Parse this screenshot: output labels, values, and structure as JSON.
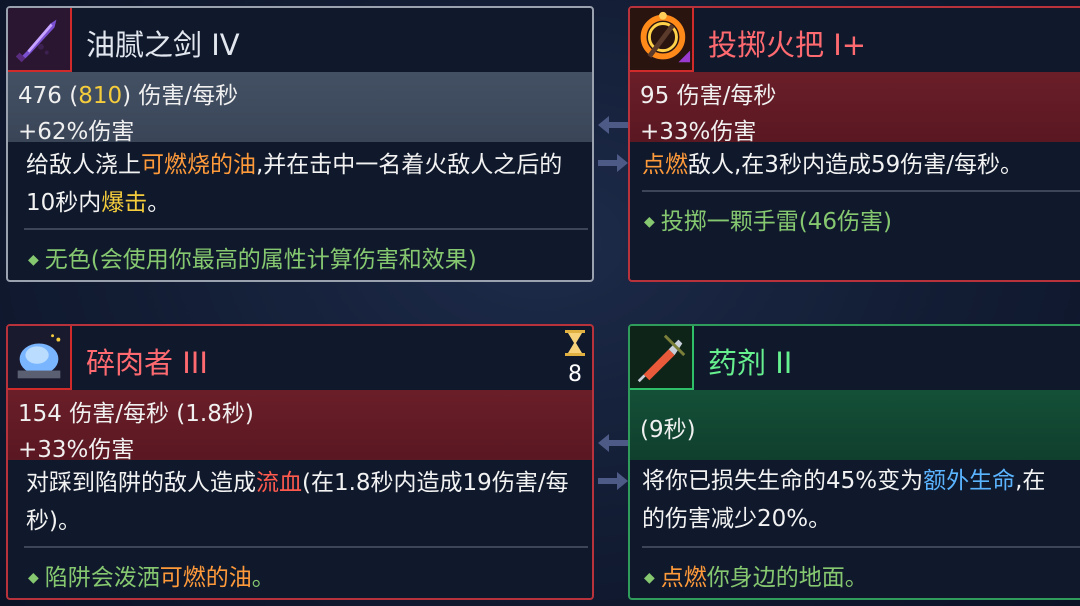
{
  "cards": {
    "oil_sword": {
      "name": "油腻之剑",
      "tier": "IV",
      "dps": "476",
      "dps_open": "(",
      "dps_hi": "810",
      "dps_close": ")",
      "dps_unit": "伤害/每秒",
      "bonus": "+62%伤害",
      "desc_1": "给敌人浇上",
      "desc_oil": "可燃烧的油",
      "desc_2": ",并在击中一名着火敌人之后的10秒内",
      "desc_crit": "爆击",
      "desc_3": "。",
      "note": "无色(会使用你最高的属性计算伤害和效果)"
    },
    "torch": {
      "name": "投掷火把",
      "tier": "I+",
      "dps": "95",
      "dps_unit": "伤害/每秒",
      "bonus": "+33%伤害",
      "desc_ignite": "点燃",
      "desc_rest": "敌人,在3秒内造成59伤害/每秒。",
      "note": "投掷一颗手雷(46伤害)"
    },
    "meat_grinder": {
      "name": "碎肉者",
      "tier": "III",
      "dps_line": "154 伤害/每秒 (1.8秒)",
      "bonus": "+33%伤害",
      "desc_1": "对踩到陷阱的敌人造成",
      "desc_bleed": "流血",
      "desc_2": "(在1.8秒内造成19伤害/每秒)。",
      "note_1": "陷阱会泼洒",
      "note_oil": "可燃的油",
      "note_2": "。",
      "cooldown": "8"
    },
    "potion": {
      "name": "药剂",
      "tier": "II",
      "duration": "(9秒)",
      "desc_1": "将你已损失生命的45%变为",
      "desc_extra": "额外生命",
      "desc_2": ",在",
      "desc_line2": "的伤害减少20%。",
      "note_ignite": "点燃",
      "note_rest": "你身边的地面。"
    }
  },
  "colors": {
    "gray_border": "#9aa2b0",
    "red_border": "#b8323b",
    "green_border": "#2f9c5b",
    "gold_value": "#f4cc3c",
    "oil_orange": "#ff9a3a",
    "bleed_red": "#ff5a4e",
    "extra_life_blue": "#5ab4ff",
    "note_green": "#86c870"
  },
  "icons": {
    "oil_sword": "oily-sword-icon",
    "torch": "torch-icon",
    "meat_grinder": "meat-grinder-trap-icon",
    "potion": "syringe-potion-icon",
    "timer": "hourglass-icon",
    "swap": "swap-arrows-icon"
  }
}
